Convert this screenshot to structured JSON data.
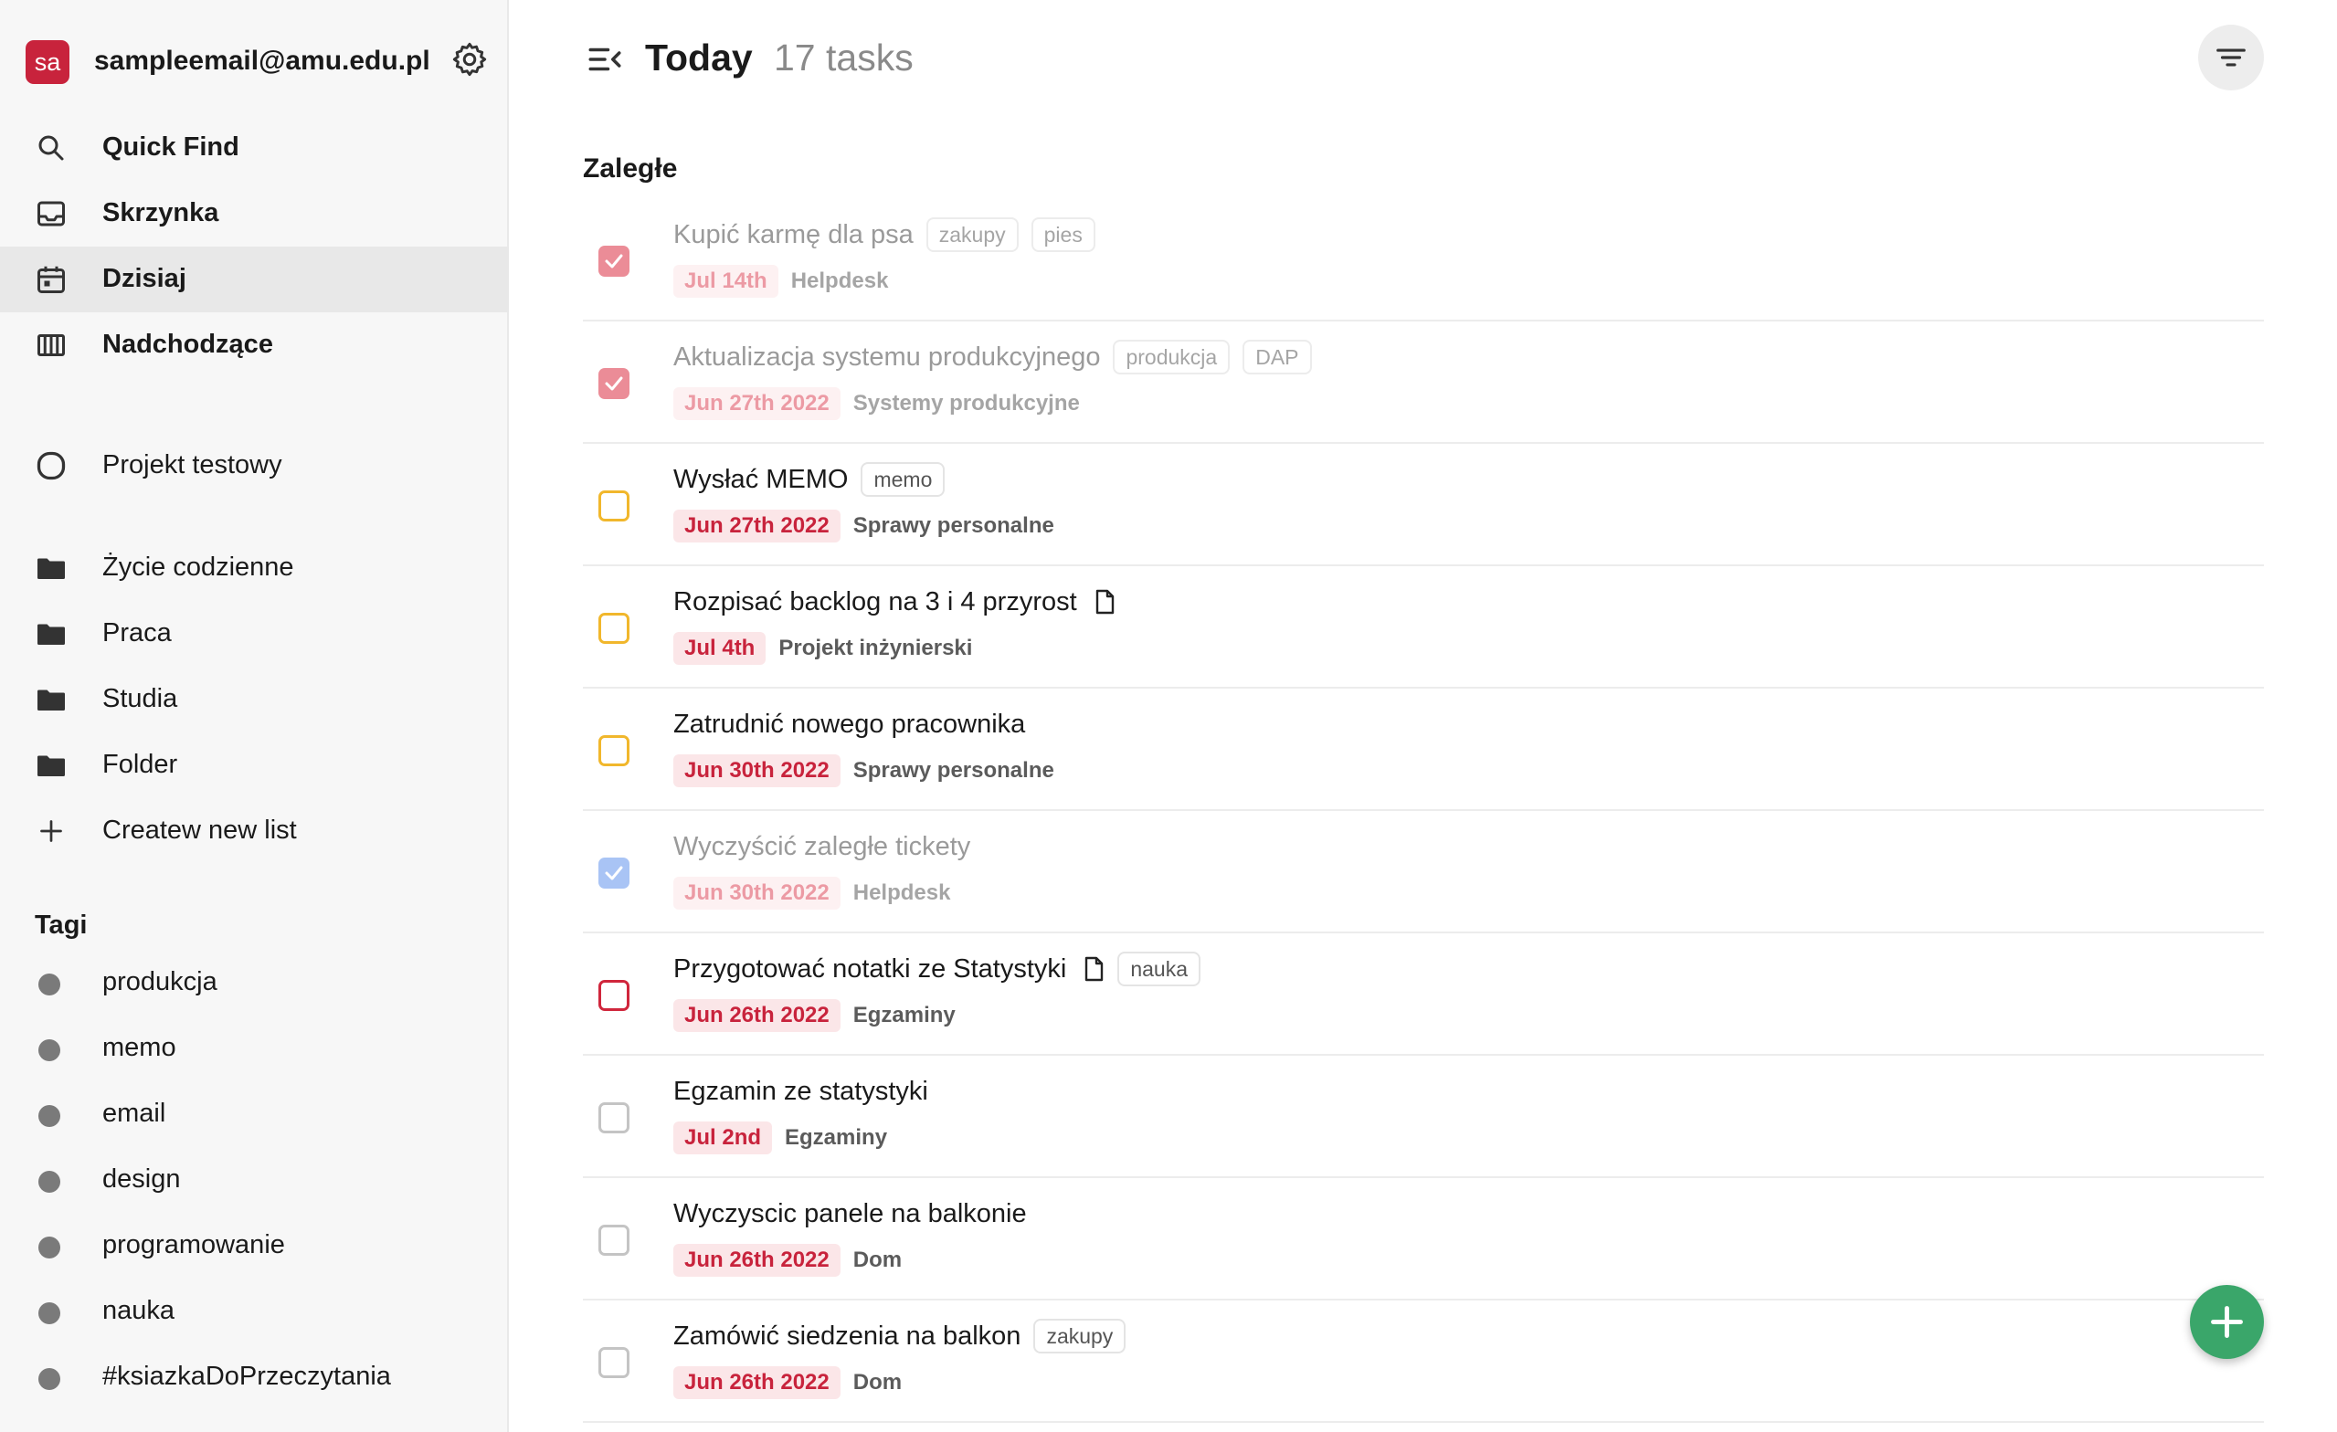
{
  "account": {
    "avatar_initials": "sa",
    "email": "sampleemail@amu.edu.pl"
  },
  "nav": [
    {
      "label": "Quick Find",
      "icon": "search-icon"
    },
    {
      "label": "Skrzynka",
      "icon": "inbox-icon"
    },
    {
      "label": "Dzisiaj",
      "icon": "calendar-icon",
      "active": true
    },
    {
      "label": "Nadchodzące",
      "icon": "board-icon"
    }
  ],
  "projects": [
    {
      "label": "Projekt testowy",
      "icon": "circle-icon"
    }
  ],
  "folders": [
    {
      "label": "Życie codzienne",
      "icon": "folder-icon"
    },
    {
      "label": "Praca",
      "icon": "folder-icon"
    },
    {
      "label": "Studia",
      "icon": "folder-icon"
    },
    {
      "label": "Folder",
      "icon": "folder-icon"
    }
  ],
  "create_list": {
    "label": "Createw new list",
    "icon": "plus-icon"
  },
  "tags_section": {
    "title": "Tagi",
    "items": [
      "produkcja",
      "memo",
      "email",
      "design",
      "programowanie",
      "nauka",
      "#ksiazkaDoPrzeczytania"
    ]
  },
  "header": {
    "title": "Today",
    "task_count": "17 tasks",
    "filter_icon": "filter-icon",
    "menu_icon": "menu-collapse-icon"
  },
  "group": {
    "title": "Zaległe"
  },
  "tasks": [
    {
      "title": "Kupić karmę dla psa",
      "tags": [
        "zakupy",
        "pies"
      ],
      "due": "Jul 14th",
      "project": "Helpdesk",
      "checkbox": "checked-red",
      "done": true,
      "has_note": false
    },
    {
      "title": "Aktualizacja systemu produkcyjnego",
      "tags": [
        "produkcja",
        "DAP"
      ],
      "due": "Jun 27th 2022",
      "project": "Systemy produkcyjne",
      "checkbox": "checked-red",
      "done": true,
      "has_note": false
    },
    {
      "title": "Wysłać MEMO",
      "tags": [
        "memo"
      ],
      "due": "Jun 27th 2022",
      "project": "Sprawy personalne",
      "checkbox": "yellow",
      "done": false,
      "has_note": false
    },
    {
      "title": "Rozpisać backlog na 3 i 4 przyrost",
      "tags": [],
      "due": "Jul 4th",
      "project": "Projekt inżynierski",
      "checkbox": "yellow",
      "done": false,
      "has_note": true
    },
    {
      "title": "Zatrudnić nowego pracownika",
      "tags": [],
      "due": "Jun 30th 2022",
      "project": "Sprawy personalne",
      "checkbox": "yellow",
      "done": false,
      "has_note": false
    },
    {
      "title": "Wyczyścić zaległe tickety",
      "tags": [],
      "due": "Jun 30th 2022",
      "project": "Helpdesk",
      "checkbox": "checked-blue",
      "done": true,
      "has_note": false
    },
    {
      "title": "Przygotować notatki ze Statystyki",
      "tags": [
        "nauka"
      ],
      "due": "Jun 26th 2022",
      "project": "Egzaminy",
      "checkbox": "red",
      "done": false,
      "has_note": true
    },
    {
      "title": "Egzamin ze statystyki",
      "tags": [],
      "due": "Jul 2nd",
      "project": "Egzaminy",
      "checkbox": "grey",
      "done": false,
      "has_note": false
    },
    {
      "title": "Wyczyscic panele na balkonie",
      "tags": [],
      "due": "Jun 26th 2022",
      "project": "Dom",
      "checkbox": "grey",
      "done": false,
      "has_note": false
    },
    {
      "title": "Zamówić siedzenia na balkon",
      "tags": [
        "zakupy"
      ],
      "due": "Jun 26th 2022",
      "project": "Dom",
      "checkbox": "grey",
      "done": false,
      "has_note": false
    }
  ],
  "fab": {
    "icon": "plus-icon"
  },
  "colors": {
    "avatar": "#c8233c",
    "due_text": "#c8233c",
    "due_bg": "#fbe6e8",
    "priority_yellow": "#f1b72c",
    "priority_red": "#d0263c",
    "checked_red": "#eb8c97",
    "checked_blue": "#a9c4f5",
    "fab": "#3aa66a"
  }
}
